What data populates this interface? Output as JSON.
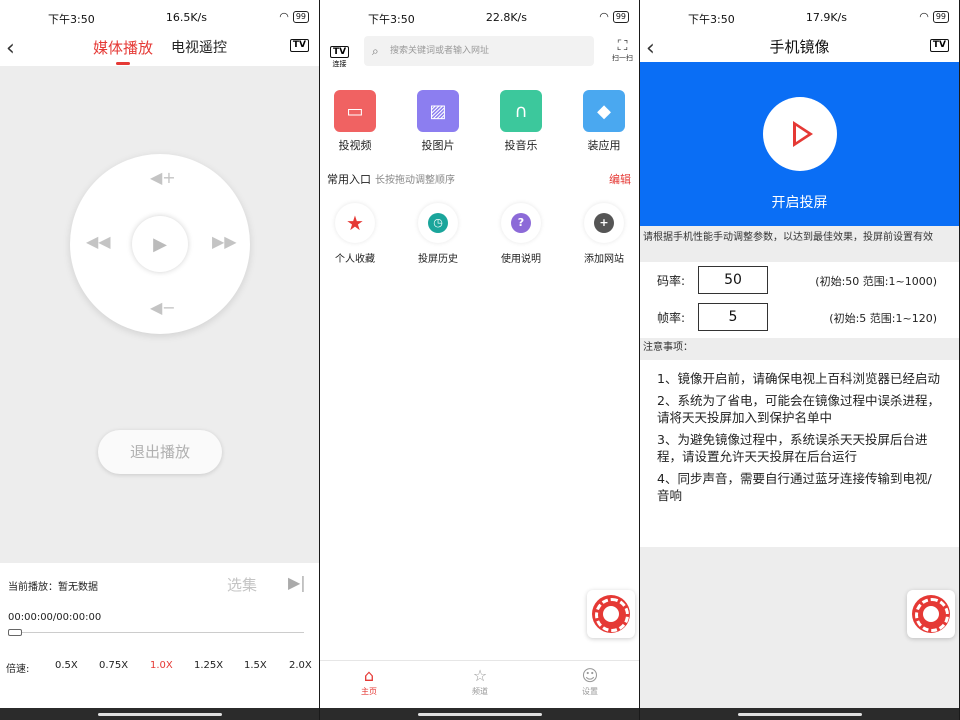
{
  "status": {
    "s1": {
      "time": "下午3:50",
      "net": "16.5K/s",
      "battery": "99"
    },
    "s2": {
      "time": "下午3:50",
      "net": "22.8K/s",
      "battery": "99"
    },
    "s3": {
      "time": "下午3:50",
      "net": "17.9K/s",
      "battery": "99"
    }
  },
  "screen1": {
    "tabs": [
      "媒体播放",
      "电视遥控"
    ],
    "tv_badge": "TV",
    "exit_label": "退出播放",
    "now_playing": "当前播放：暂无数据",
    "select_episode": "选集",
    "timecode": "00:00:00/00:00:00",
    "speed_label": "倍速:",
    "speeds": [
      "0.5X",
      "0.75X",
      "1.0X",
      "1.25X",
      "1.5X",
      "2.0X"
    ],
    "active_speed": "1.0X"
  },
  "screen2": {
    "connect_badge": "TV",
    "connect_label": "连接",
    "search_placeholder": "搜索关键词或者输入网址",
    "scan_label": "扫一扫",
    "features": [
      {
        "label": "投视频",
        "color": "#f06262",
        "icon": "video-icon"
      },
      {
        "label": "投图片",
        "color": "#8c7ef0",
        "icon": "image-icon"
      },
      {
        "label": "投音乐",
        "color": "#3cc89c",
        "icon": "headphones-icon"
      },
      {
        "label": "装应用",
        "color": "#4aa8f0",
        "icon": "cube-icon"
      }
    ],
    "common_title": "常用入口",
    "common_hint": "长按拖动调整顺序",
    "edit_label": "编辑",
    "shortcuts": [
      {
        "label": "个人收藏",
        "color": "#e53935",
        "icon": "star-icon"
      },
      {
        "label": "投屏历史",
        "color": "#1aa59b",
        "icon": "clock-icon"
      },
      {
        "label": "使用说明",
        "color": "#8c6ad8",
        "icon": "question-icon"
      },
      {
        "label": "添加网站",
        "color": "#555555",
        "icon": "plus-icon"
      }
    ],
    "tabbar": [
      "主页",
      "频道",
      "设置"
    ]
  },
  "screen3": {
    "title": "手机镜像",
    "tv_badge": "TV",
    "start_label": "开启投屏",
    "tip": "请根据手机性能手动调整参数，以达到最佳效果，投屏前设置有效",
    "bitrate_label": "码率:",
    "bitrate_value": "50",
    "bitrate_range": "(初始:50 范围:1~1000)",
    "fps_label": "帧率:",
    "fps_value": "5",
    "fps_range": "(初始:5 范围:1~120)",
    "notes_title": "注意事项：",
    "notes": [
      "1、镜像开启前，请确保电视上百科浏览器已经启动",
      "2、系统为了省电，可能会在镜像过程中误杀进程，请将天天投屏加入到保护名单中",
      "3、为避免镜像过程中，系统误杀天天投屏后台进程，请设置允许天天投屏在后台运行",
      "4、同步声音，需要自行通过蓝牙连接传输到电视/音响"
    ]
  },
  "colors": {
    "accent": "#e53935",
    "mirror_blue": "#0a6ef5"
  }
}
